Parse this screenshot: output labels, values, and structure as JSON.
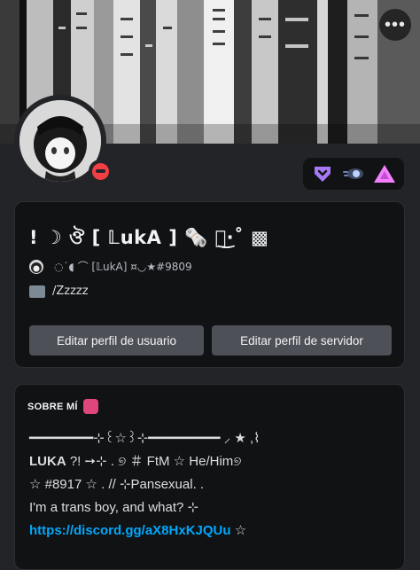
{
  "header": {
    "more_label": "•••"
  },
  "profile": {
    "display_name": "! ☽ ঔ [ 𝕃ukA ] 🗞️ ꒰͜·˚ ▩",
    "tag_text": "◌˙◖ ⌒ [𝕃ukA] ¤◡★#9809",
    "custom_status": "/Zzzzz",
    "status": "dnd",
    "status_color": "#f23f43"
  },
  "badges": [
    {
      "icon": "nitro-icon",
      "color": "#a67af4"
    },
    {
      "icon": "server-boost-icon",
      "color": "#bdd4ff"
    },
    {
      "icon": "hypesquad-balance-icon",
      "color": "#f47fff"
    }
  ],
  "buttons": {
    "edit_user": "Editar perfil de usuario",
    "edit_server": "Editar perfil de servidor"
  },
  "about": {
    "title": "SOBRE MÍ",
    "line1": "━━━━━━━━⊹꒰☆꒱⊹━━━━━━━━━ ⸝ ★ ,⌇",
    "line2_name": "LUKA",
    "line2_rest": " ?! ➙⊹ . ୭ ＃ FtM ☆ He/Him୭",
    "line3": " ☆ #8917 ☆ . // ⊹Pansexual. .",
    "line4": "I'm a trans boy, and what? ⊹",
    "link": "https://discord.gg/aX8HxKJQUu",
    "link_suffix": " ☆"
  }
}
